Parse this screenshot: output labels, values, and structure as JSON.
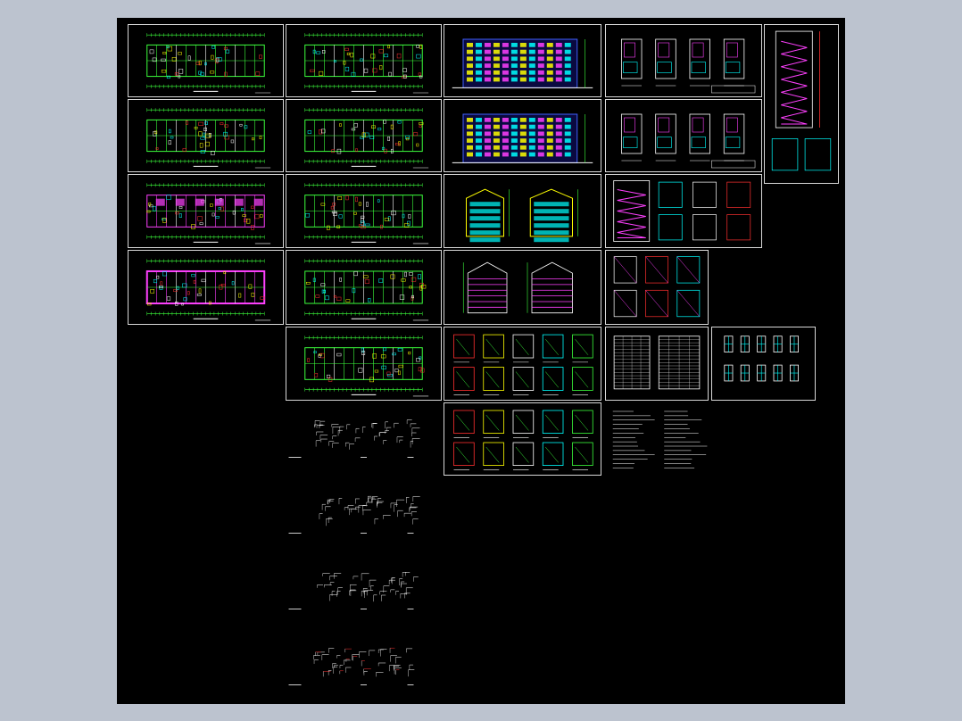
{
  "viewer": {
    "background_color": "#bcc3cf",
    "canvas_color": "#000000",
    "frame_color": "#d8d8d8"
  },
  "palette": {
    "wall": "#3cff3c",
    "dimension": "#3cff3c",
    "text": "#ffffff",
    "accent_cyan": "#00ffff",
    "accent_yellow": "#ffff00",
    "accent_magenta": "#ff40ff",
    "accent_red": "#ff3030",
    "accent_blue": "#4060ff"
  },
  "drawing_sets": {
    "floor_plans": {
      "type": "floor-plan"
    },
    "elevations": {
      "type": "elevation"
    },
    "sections": {
      "type": "section"
    },
    "details": {
      "type": "detail"
    },
    "tables": {
      "type": "table"
    },
    "windows": {
      "type": "window-schedule"
    },
    "notes": {
      "type": "notes"
    }
  }
}
